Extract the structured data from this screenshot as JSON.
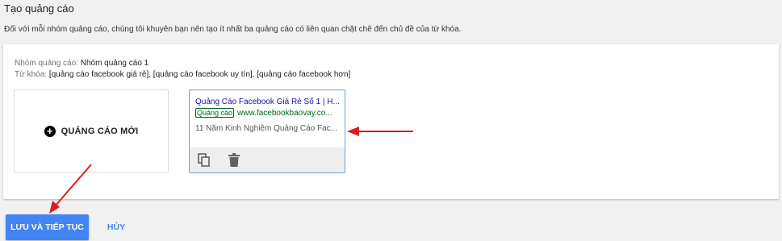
{
  "page": {
    "title": "Tạo quảng cáo",
    "description": "Đối với mỗi nhóm quảng cáo, chúng tôi khuyên bạn nên tạo ít nhất ba quảng cáo có liên quan chặt chẽ đến chủ đề của từ khóa."
  },
  "ad_group": {
    "label": "Nhóm quảng cáo: ",
    "value": "Nhóm quảng cáo 1"
  },
  "keywords": {
    "label": "Từ khóa: ",
    "value": "[quảng cáo facebook giá rẻ], [quảng cáo facebook uy tín], [quảng cáo facebook hơn]"
  },
  "new_ad": {
    "icon": "plus-circle-icon",
    "label": "QUẢNG CÁO MỚI"
  },
  "ad_preview": {
    "headline": "Quảng Cáo Facebook Giá Rẻ Số 1 | H...",
    "badge": "Quảng cáo",
    "display_url": "www.facebookbaovay.co...",
    "description": "11 Năm Kinh Nghiệm Quảng Cáo Fac...",
    "actions": [
      "copy-icon",
      "trash-icon"
    ]
  },
  "buttons": {
    "save": "LƯU VÀ TIẾP TỤC",
    "cancel": "HỦY"
  },
  "colors": {
    "primary": "#4285f4",
    "annotation_arrow": "#e01b1b",
    "ad_headline": "#1a0dab",
    "ad_url": "#006621"
  }
}
